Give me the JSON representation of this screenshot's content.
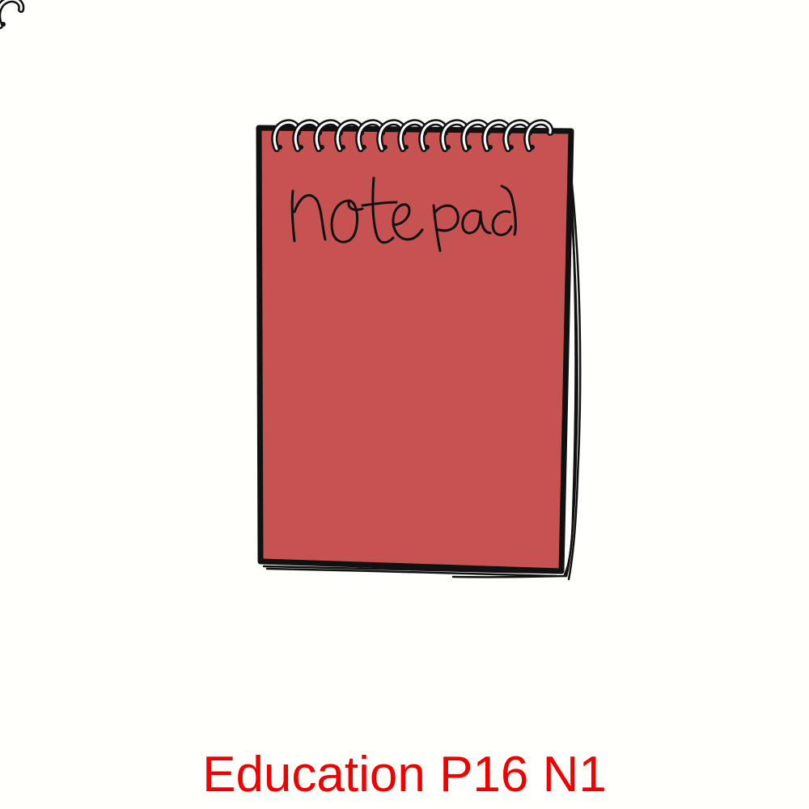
{
  "caption": "Education P16 N1",
  "illustration": {
    "subject": "spiral notepad",
    "handwritten_title": "notepad",
    "icon": "notepad-icon"
  },
  "colors": {
    "background": "#fffffb",
    "cover": "#c65252",
    "ink": "#111111",
    "caption": "#f00000"
  }
}
